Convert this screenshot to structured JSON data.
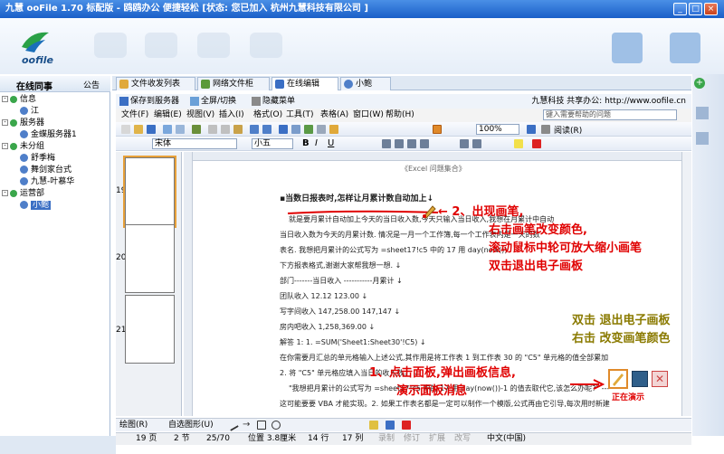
{
  "window": {
    "title": "九慧 ooFile 1.70 标配版 - 鸥鸥办公 便捷轻松 [状态: 您已加入 杭州九慧科技有限公司 ]",
    "btn_min": "_",
    "btn_max": "□",
    "btn_close": "×"
  },
  "brand": {
    "logo_text": "oofile"
  },
  "sidebar": {
    "title": "在线同事",
    "announce": "公告",
    "groups": [
      {
        "name": "信息",
        "members": [
          "江"
        ]
      },
      {
        "name": "服务器",
        "members": [
          "金蝶服务器1"
        ]
      },
      {
        "name": "未分组",
        "members": [
          "舒季梅",
          "舞剑家台式",
          "九慧-叶慕华"
        ]
      },
      {
        "name": "运营部",
        "members": [
          "小鲍"
        ]
      }
    ]
  },
  "tabs": [
    "文件收发列表",
    "网络文件柜",
    "在线编辑",
    "小鲍"
  ],
  "doc_toolbar": {
    "save_to_server": "保存到服务器",
    "fullscreen": "全屏/切换",
    "hide_menu": "隐藏菜单",
    "company": "九慧科技 共享办公: http://www.oofile.cn"
  },
  "menu": [
    "文件(F)",
    "编辑(E)",
    "视图(V)",
    "插入(I)",
    "格式(O)",
    "工具(T)",
    "表格(A)",
    "窗口(W)",
    "帮助(H)"
  ],
  "help_placeholder": "键入需要帮助的问题",
  "format": {
    "font": "宋体",
    "size": "小五",
    "zoom": "100%",
    "read_btn": "阅读(R)"
  },
  "thumb_pages": [
    "19",
    "20",
    "21"
  ],
  "doc": {
    "header": "《Excel 问题集合》",
    "title": "▪当数日报表时,怎样让月累计数自动加上↓",
    "lines": [
      "就是要月累计自动加上今天的当日收入数,今天只输入当日收入,我想在月累计中自动",
      "当日收入数为今天的月累计数. 情况是一月一个工作簿,每一个工作表内是一天的数",
      "表名. 我想把月累计的公式写为 =sheet17!c5 中的 17 用 day(now())",
      "下方报表格式,谢谢大家帮我想一想. ↓",
      "部门-------当日收入 -----------月累计 ↓",
      "团队收入 12.12 123.00 ↓",
      "写字间收入 147,258.00 147,147 ↓",
      "房内吧收入 1,258,369.00 ↓",
      "解答 1: 1. =SUM('Sheet1:Sheet30'!C5) ↓",
      "在你需要月汇总的单元格输入上述公式,其作用是将工作表 1 到工作表 30 的 \"C5\" 单元格的值全部累加",
      "2. 将 \"C5\" 单元格应填入当日的收入数。 ↓",
      "\"我想把月累计的公式写为 =sheet17!c5 中的 17 用 day(now())-1 的值去取代它,该怎么办呢?\" ---",
      "这可能要要 VBA 才能实现。2. 如果工作表名都是一定可以制作一个模版,公式再由它引导,每次用时新建",
      "一工作簿即可. \"把月累计(月汇总)写在 sheet32 中,\" 还没搞清我的意思\",还没搞",
      "到方法,调试好了再告诉你。3. =INDIRECT(ADDRESS(1,1,1,1,",
      "▪单元格 A1=(a1 a2 a3 a4 a5)其中一个就返回 AA,如果 A1=a6 就返回 BB, 否则就返回 CC"
    ]
  },
  "annotations": {
    "a2": [
      "← 2、出现画笔,",
      "右击画笔改变颜色,",
      "滚动鼠标中轮可放大缩小画笔",
      "双击退出电子画板"
    ],
    "a1": [
      "1、点击面板,弹出画板信息,",
      "演示面板消息"
    ],
    "side": [
      "双击  退出电子画板",
      "右击  改变画笔颜色"
    ],
    "demo": "正在演示"
  },
  "drawbar": {
    "draw": "绘图(R)",
    "autoshape": "自选图形(U)"
  },
  "status": [
    "19 页",
    "2 节",
    "25/70",
    "位置 3.8厘米",
    "14 行",
    "17 列",
    "录制",
    "修订",
    "扩展",
    "改写",
    "中文(中国)"
  ],
  "colors": {
    "titlebar": "#1a5fc8",
    "annotation_red": "#e00000",
    "annotation_olive": "#8a7a00",
    "accent": "#3aa64b"
  }
}
